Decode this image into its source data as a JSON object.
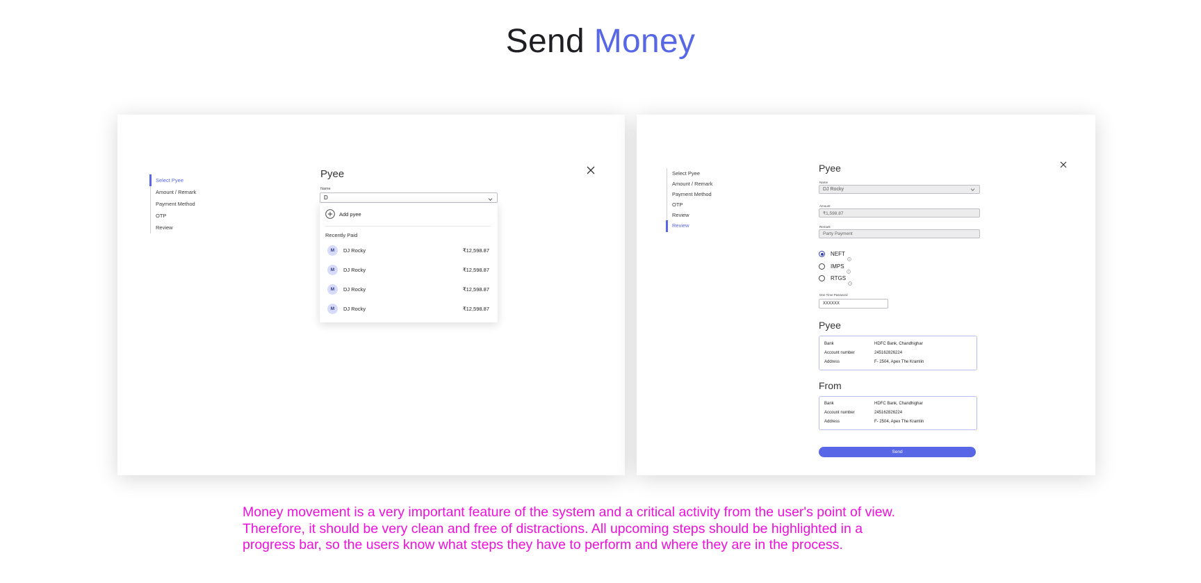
{
  "header": {
    "title_part1": "Send",
    "title_part2": "Money",
    "accent_color": "#5867e6"
  },
  "left_screen": {
    "stepper": [
      {
        "label": "Select Pyee",
        "active": true
      },
      {
        "label": "Amount / Remark",
        "active": false
      },
      {
        "label": "Payment Method",
        "active": false
      },
      {
        "label": "OTP",
        "active": false
      },
      {
        "label": "Review",
        "active": false
      }
    ],
    "section_title": "Pyee",
    "name_label": "Name",
    "name_value": "D",
    "dropdown": {
      "add_label": "Add pyee",
      "recent_title": "Recently Paid",
      "payees": [
        {
          "initial": "M",
          "name": "DJ Rocky",
          "amount": "₹12,598.87"
        },
        {
          "initial": "M",
          "name": "DJ Rocky",
          "amount": "₹12,598.87"
        },
        {
          "initial": "M",
          "name": "DJ Rocky",
          "amount": "₹12,598.87"
        },
        {
          "initial": "M",
          "name": "DJ Rocky",
          "amount": "₹12,598.87"
        }
      ]
    },
    "close_icon": "close-icon"
  },
  "right_screen": {
    "stepper": [
      {
        "label": "Select Pyee",
        "active": false
      },
      {
        "label": "Amount / Remark",
        "active": false
      },
      {
        "label": "Payment Method",
        "active": false
      },
      {
        "label": "OTP",
        "active": false
      },
      {
        "label": "Review",
        "active": false
      },
      {
        "label": "Review",
        "active": true
      }
    ],
    "section_title": "Pyee",
    "name_label": "Name",
    "name_value": "DJ Rocky",
    "amount_label": "Amount",
    "amount_value": "₹1,598.87",
    "remark_label": "Remark",
    "remark_value": "Party Payment",
    "payment_methods": [
      {
        "label": "NEFT",
        "checked": true
      },
      {
        "label": "IMPS",
        "checked": false
      },
      {
        "label": "RTGS",
        "checked": false
      }
    ],
    "otp_label": "One Time Password",
    "otp_value": "XXXXXX",
    "payee_section_title": "Pyee",
    "payee_details": [
      {
        "key": "Bank",
        "value": "HDFC Bank, Chandhighar"
      },
      {
        "key": "Account number",
        "value": "245162826224"
      },
      {
        "key": "Address",
        "value": "F- 2504, Apex The Kramlin"
      }
    ],
    "from_section_title": "From",
    "from_details": [
      {
        "key": "Bank",
        "value": "HDFC Bank, Chandhighar"
      },
      {
        "key": "Account number",
        "value": "245162826224"
      },
      {
        "key": "Address",
        "value": "F- 2504, Apex The Kramlin"
      }
    ],
    "send_label": "Send"
  },
  "description": {
    "line1": "Money movement is a very important feature of the system and a critical activity from the user's point of view.",
    "line2": "Therefore, it should be very clean and free of distractions. All upcoming steps should be highlighted in a",
    "line3": "progress bar, so the users know what steps they have to perform and where they are in the process."
  }
}
